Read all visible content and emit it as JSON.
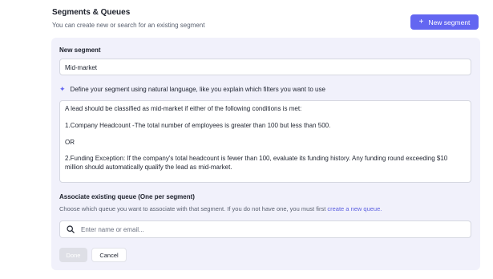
{
  "header": {
    "title": "Segments & Queues",
    "subtitle": "You can create new or search for an existing segment",
    "new_button_label": "New segment",
    "new_button_icon": "plus-icon"
  },
  "form": {
    "segment_label": "New segment",
    "segment_value": "Mid-market",
    "ai_icon": "sparkle-icon",
    "ai_prompt": "Define your segment using natural language, like you explain which filters you want to use",
    "description": {
      "line1": "A lead should be classified as mid-market if either of the following conditions is met:",
      "line2": "1.Company Headcount -The total number of employees is greater than 100 but less than 500.",
      "line3": "OR",
      "line4": "2.Funding Exception: If the company's total headcount is fewer than 100, evaluate its funding history. Any funding round exceeding $10 million should automatically qualify the lead as mid-market."
    },
    "queue_label": "Associate existing queue (One per segment)",
    "queue_help": "Choose which queue you want to associate with that segment. If you do not have one, you must first",
    "queue_link": "create a new queue.",
    "search_icon": "search-icon",
    "search_placeholder": "Enter name or email...",
    "done_label": "Done",
    "cancel_label": "Cancel"
  },
  "colors": {
    "accent": "#6366f1",
    "panel_bg": "#f1f1fb",
    "link": "#5b5fe0"
  }
}
